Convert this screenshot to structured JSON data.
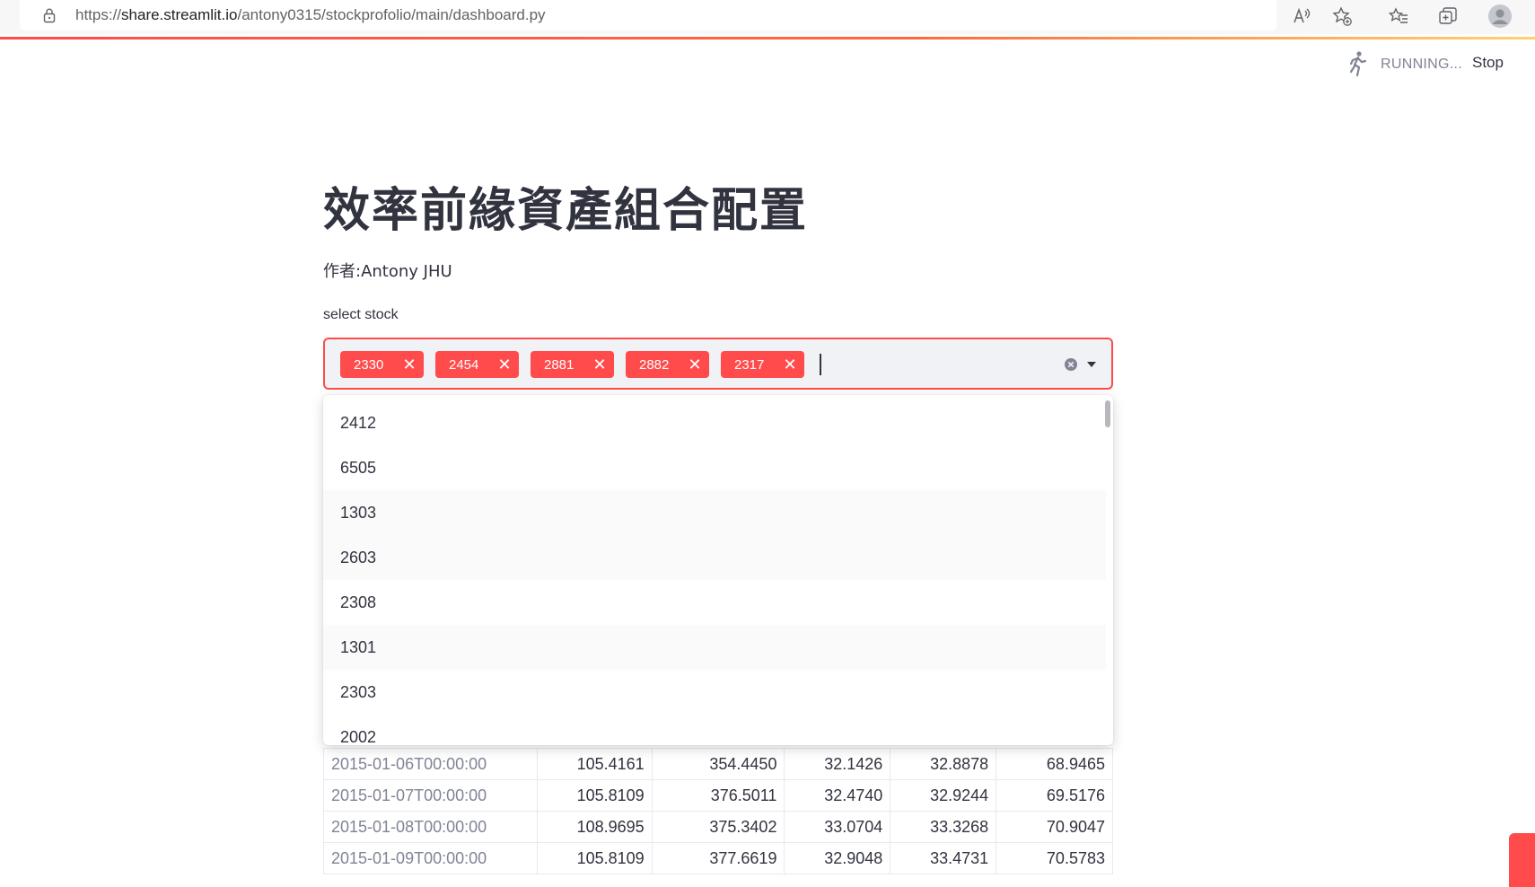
{
  "browser": {
    "url_prefix": "https://",
    "url_host": "share.streamlit.io",
    "url_path": "/antony0315/stockprofolio/main/dashboard.py"
  },
  "header": {
    "status_text": "RUNNING...",
    "stop_label": "Stop"
  },
  "main": {
    "title": "效率前緣資產組合配置",
    "author": "作者:Antony JHU",
    "select_label": "select stock"
  },
  "multiselect": {
    "selected": [
      "2330",
      "2454",
      "2881",
      "2882",
      "2317"
    ],
    "remove_glyph": "✕"
  },
  "dropdown": {
    "options": [
      "2412",
      "6505",
      "1303",
      "2603",
      "2308",
      "1301",
      "2303",
      "2002"
    ]
  },
  "table": {
    "rows": [
      {
        "date": "2015-01-06T00:00:00",
        "values": [
          "105.4161",
          "354.4450",
          "32.1426",
          "32.8878",
          "68.9465"
        ]
      },
      {
        "date": "2015-01-07T00:00:00",
        "values": [
          "105.8109",
          "376.5011",
          "32.4740",
          "32.9244",
          "69.5176"
        ]
      },
      {
        "date": "2015-01-08T00:00:00",
        "values": [
          "108.9695",
          "375.3402",
          "33.0704",
          "33.3268",
          "70.9047"
        ]
      },
      {
        "date": "2015-01-09T00:00:00",
        "values": [
          "105.8109",
          "377.6619",
          "32.9048",
          "33.4731",
          "70.5783"
        ]
      }
    ]
  },
  "colors": {
    "accent": "#ff4b4b",
    "text": "#31333f",
    "muted": "#808495",
    "input_bg": "#f0f2f6"
  }
}
